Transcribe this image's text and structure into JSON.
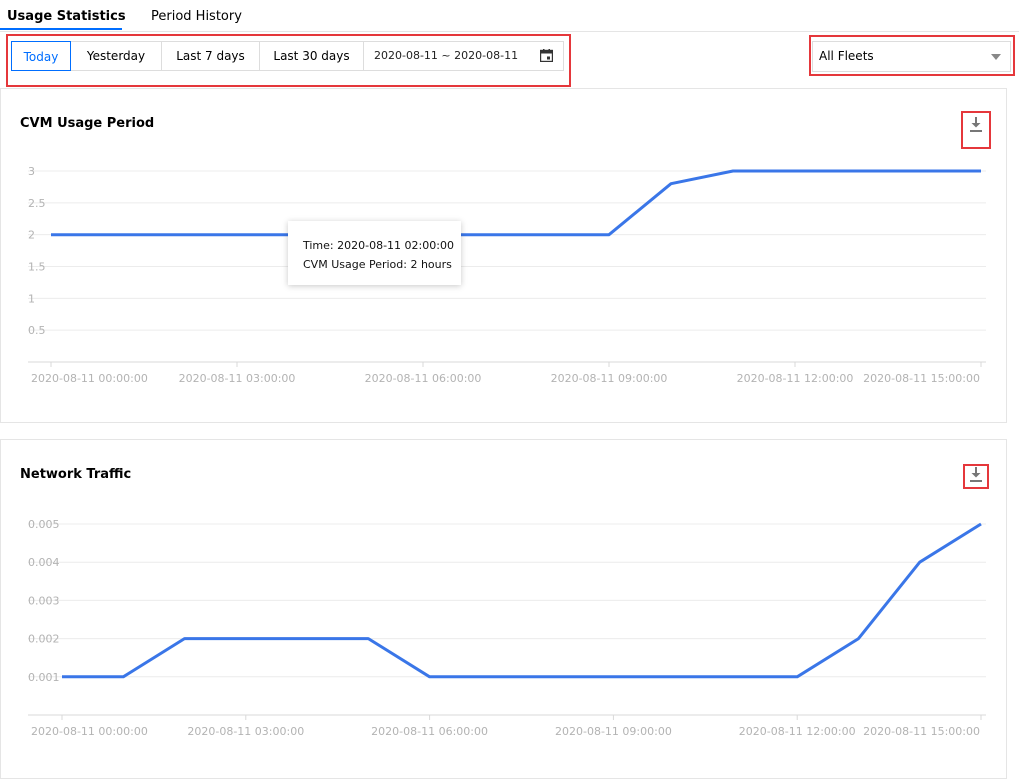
{
  "tabs": [
    {
      "label": "Usage Statistics",
      "active": true
    },
    {
      "label": "Period History",
      "active": false
    }
  ],
  "date_range": {
    "buttons": [
      "Today",
      "Yesterday",
      "Last 7 days",
      "Last 30 days"
    ],
    "selected": "Today",
    "picker_value": "2020-08-11 ~ 2020-08-11"
  },
  "fleet_select": {
    "value": "All Fleets"
  },
  "colors": {
    "accent": "#006eff",
    "line": "#3a76e8",
    "annotation": "#e5373b"
  },
  "charts": {
    "cvm": {
      "title": "CVM Usage Period",
      "download_icon": "download-icon",
      "tooltip": {
        "time_line": "Time: 2020-08-11 02:00:00",
        "value_line": "CVM Usage Period: 2 hours"
      }
    },
    "network": {
      "title": "Network Traffic",
      "download_icon": "download-icon"
    }
  },
  "chart_data": [
    {
      "type": "line",
      "title": "CVM Usage Period",
      "xlabel": "",
      "ylabel": "",
      "x_ticks": [
        "2020-08-11 00:00:00",
        "2020-08-11 03:00:00",
        "2020-08-11 06:00:00",
        "2020-08-11 09:00:00",
        "2020-08-11 12:00:00",
        "2020-08-11 15:00:00"
      ],
      "y_ticks": [
        0.5,
        1,
        1.5,
        2,
        2.5,
        3
      ],
      "ylim": [
        0,
        3
      ],
      "xlim_hours": [
        0,
        15
      ],
      "x": [
        0,
        1,
        2,
        3,
        4,
        5,
        6,
        7,
        8,
        9,
        10,
        11,
        12,
        13,
        14,
        15
      ],
      "values": [
        2,
        2,
        2,
        2,
        2,
        2,
        2,
        2,
        2,
        2,
        2.8,
        3,
        3,
        3,
        3,
        3
      ],
      "grid": true
    },
    {
      "type": "line",
      "title": "Network Traffic",
      "xlabel": "",
      "ylabel": "",
      "x_ticks": [
        "2020-08-11 00:00:00",
        "2020-08-11 03:00:00",
        "2020-08-11 06:00:00",
        "2020-08-11 09:00:00",
        "2020-08-11 12:00:00",
        "2020-08-11 15:00:00"
      ],
      "y_ticks": [
        0.001,
        0.002,
        0.003,
        0.004,
        0.005
      ],
      "ylim": [
        0,
        0.005
      ],
      "xlim_hours": [
        0,
        15
      ],
      "x": [
        0,
        1,
        2,
        3,
        4,
        5,
        6,
        7,
        8,
        9,
        10,
        11,
        12,
        13,
        14,
        15
      ],
      "values": [
        0.001,
        0.001,
        0.002,
        0.002,
        0.002,
        0.002,
        0.001,
        0.001,
        0.001,
        0.001,
        0.001,
        0.001,
        0.001,
        0.002,
        0.004,
        0.005
      ],
      "grid": true
    }
  ]
}
